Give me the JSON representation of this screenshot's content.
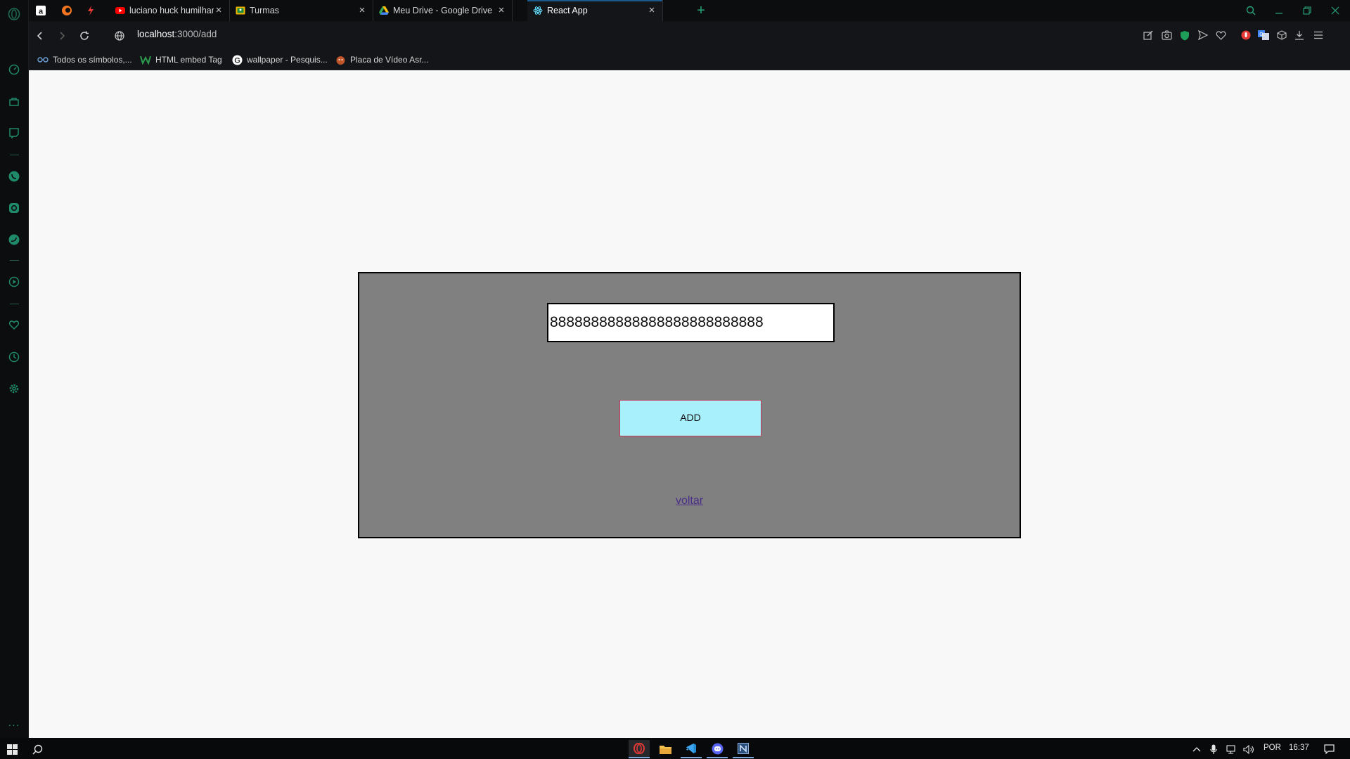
{
  "browser": {
    "tabs": [
      {
        "title": "luciano huck humilhando p",
        "active": false
      },
      {
        "title": "Turmas",
        "active": false
      },
      {
        "title": "Meu Drive - Google Drive",
        "active": false
      },
      {
        "title": "React App",
        "active": true
      }
    ],
    "address": {
      "host": "localhost",
      "path": ":3000/add"
    },
    "bookmarks": [
      {
        "label": "Todos os símbolos,..."
      },
      {
        "label": "HTML embed Tag"
      },
      {
        "label": "wallpaper - Pesquis..."
      },
      {
        "label": "Placa de Vídeo Asr..."
      }
    ],
    "accent_color": "#2aa57a"
  },
  "page": {
    "input_value": "88888888888888888888888888",
    "add_label": "ADD",
    "back_label": "voltar",
    "card_color": "#808080",
    "button_color": "#a8f0fb"
  },
  "taskbar": {
    "language": "POR",
    "time": "16:37"
  }
}
